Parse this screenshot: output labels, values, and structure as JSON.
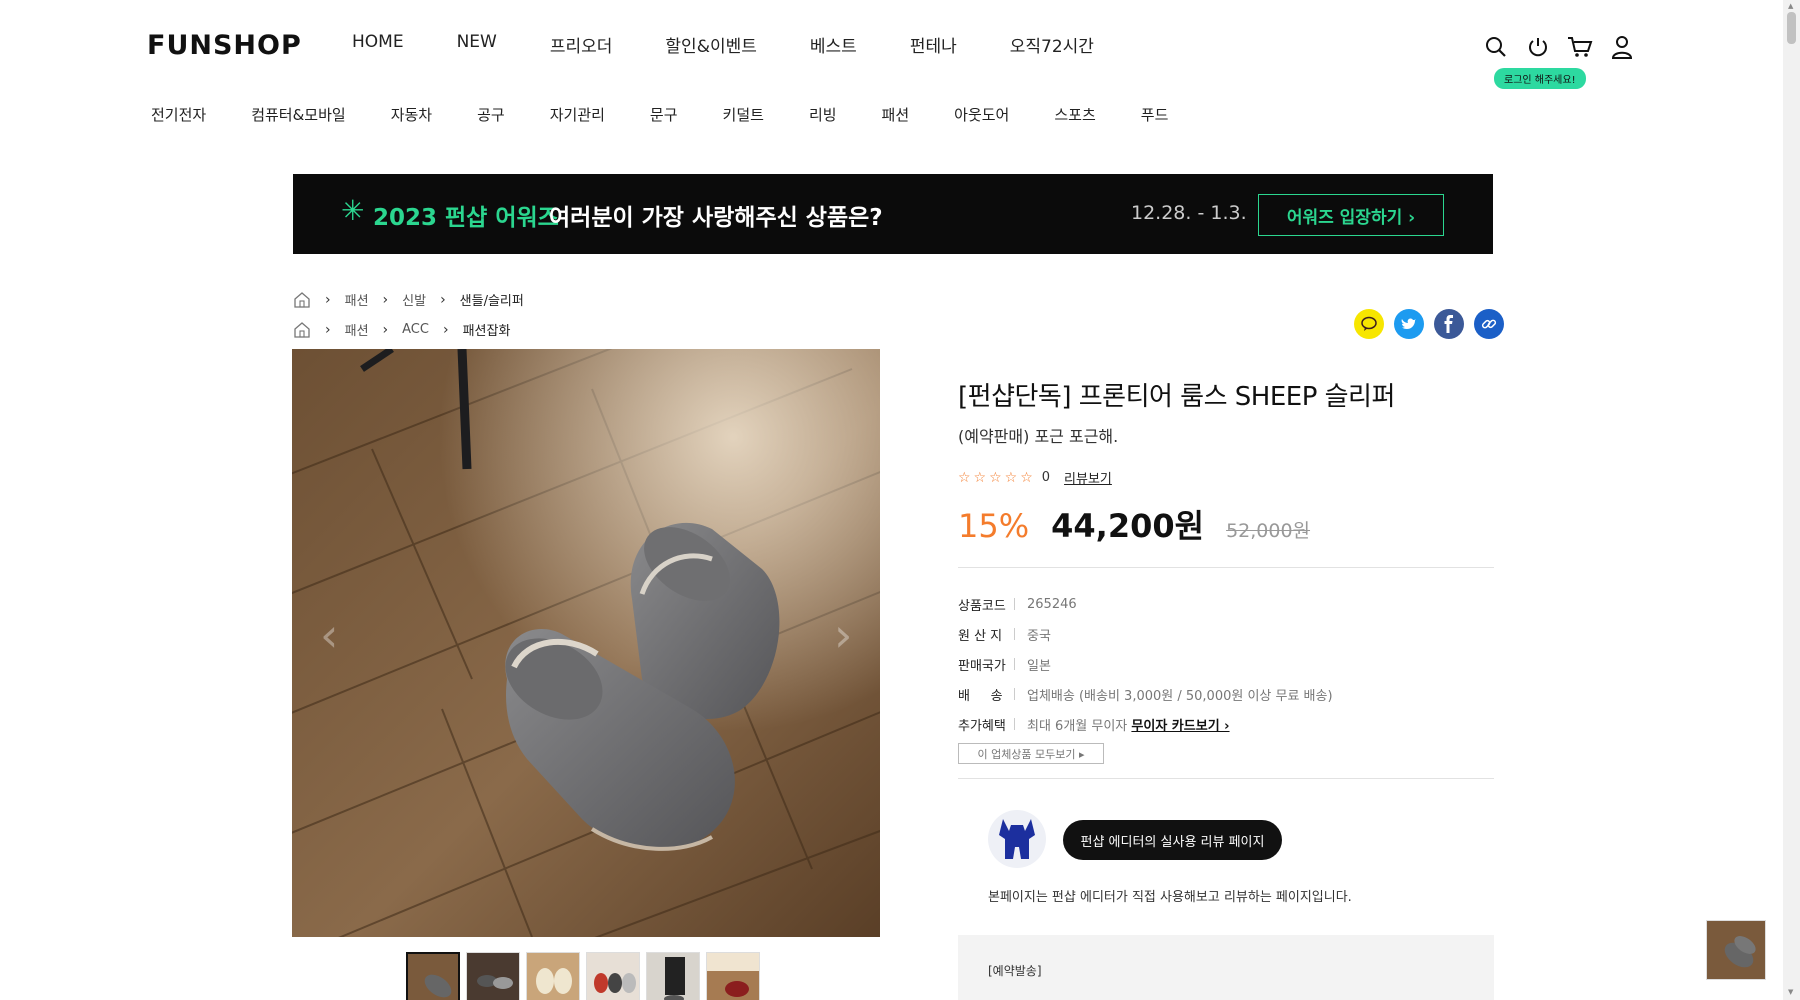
{
  "header": {
    "logo": "FUNSHOP",
    "gnb": [
      "HOME",
      "NEW",
      "프리오더",
      "할인&이벤트",
      "베스트",
      "펀테나",
      "오직72시간"
    ],
    "login_tip": "로그인 해주세요!",
    "icons": [
      "search-icon",
      "power-icon",
      "cart-icon",
      "user-icon"
    ]
  },
  "category_nav": [
    "전기전자",
    "컴퓨터&모바일",
    "자동차",
    "공구",
    "자기관리",
    "문구",
    "키덜트",
    "리빙",
    "패션",
    "아웃도어",
    "스포츠",
    "푸드"
  ],
  "banner": {
    "star": "✳",
    "year_title": "2023 펀샵 어워즈",
    "text": "여러분이 가장 사랑해주신 상품은?",
    "date": "12.28. - 1.3.",
    "button": "어워즈 입장하기 ›"
  },
  "breadcrumbs": [
    [
      "패션",
      "신발",
      "샌들/슬리퍼"
    ],
    [
      "패션",
      "ACC",
      "패션잡화"
    ]
  ],
  "share_icons": [
    "kakao-icon",
    "twitter-icon",
    "facebook-icon",
    "link-icon"
  ],
  "product": {
    "title": "[펀샵단독] 프론티어 룸스 SHEEP 슬리퍼",
    "subtitle": "(예약판매) 포근 포근해.",
    "stars": "☆☆☆☆☆",
    "rating_value": 0,
    "review_count": "0",
    "review_link": "리뷰보기",
    "discount": "15%",
    "price": "44,200원",
    "original_price": "52,000원",
    "info": [
      {
        "key": "상품코드",
        "value": "265246"
      },
      {
        "key": "원 산 지",
        "value": "중국"
      },
      {
        "key": "판매국가",
        "value": "일본"
      },
      {
        "key": "배     송",
        "value": "업체배송 (배송비 3,000원 / 50,000원 이상 무료 배송)"
      },
      {
        "key": "추가혜택",
        "value": "최대 6개월 무이자",
        "link": "무이자 카드보기 ›"
      }
    ],
    "seller_button": "이 업체상품 모두보기 ▸"
  },
  "editor": {
    "button": "펀샵 에디터의 실사용 리뷰 페이지",
    "description": "본페이지는 펀샵 에디터가 직접 사용해보고 리뷰하는 페이지입니다."
  },
  "notice": {
    "title": "[예약발송]"
  },
  "colors": {
    "accent_orange": "#f47c2c",
    "accent_green": "#2bd68f",
    "banner_bg": "#0b0b0b"
  }
}
